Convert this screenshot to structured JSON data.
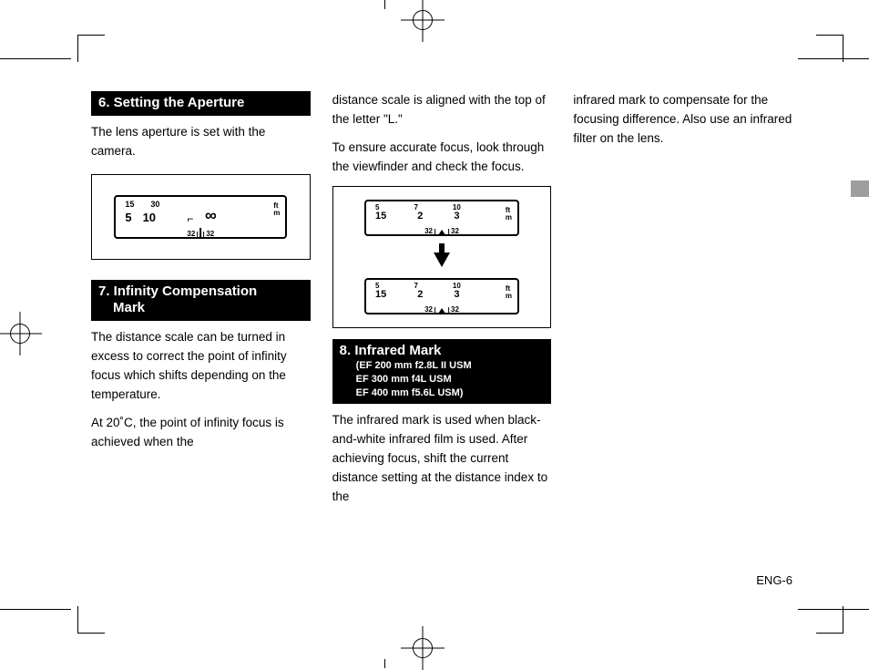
{
  "page_number": "ENG-6",
  "section6": {
    "title": "6. Setting the Aperture",
    "body": "The lens aperture is set with the camera."
  },
  "section7": {
    "title_line1": "7. Infinity Compensation",
    "title_line2": "Mark",
    "body1": "The distance scale can be turned in excess to correct the point of infinity focus which shifts depending on the temperature.",
    "body2": "At 20˚C, the point of infinity focus is achieved when the",
    "cont1": "distance scale is aligned with the top of the letter \"L.\"",
    "cont2": "To ensure accurate focus, look through the viewfinder and check the focus."
  },
  "section8": {
    "title": "8. Infrared Mark",
    "sub1": "(EF 200 mm f2.8L II USM",
    "sub2": "EF 300 mm f4L USM",
    "sub3": "EF 400 mm f5.6L USM)",
    "body1": "The infrared mark is used when black-and-white infrared film is used.  After achieving focus, shift the current distance setting at the distance index to the",
    "cont": "infrared mark to compensate for the focusing difference.  Also use an infrared filter on the lens."
  },
  "fig1": {
    "ft": [
      "15",
      "30"
    ],
    "m": [
      "5",
      "10"
    ],
    "inf": "∞",
    "units_ft": "ft",
    "units_m": "m",
    "dof_l": "32",
    "dof_r": "32"
  },
  "fig2": {
    "ft": [
      "5",
      "7",
      "10"
    ],
    "m": [
      "15",
      "2",
      "3"
    ],
    "units_ft": "ft",
    "units_m": "m",
    "dof_l": "32",
    "dof_r": "32"
  }
}
